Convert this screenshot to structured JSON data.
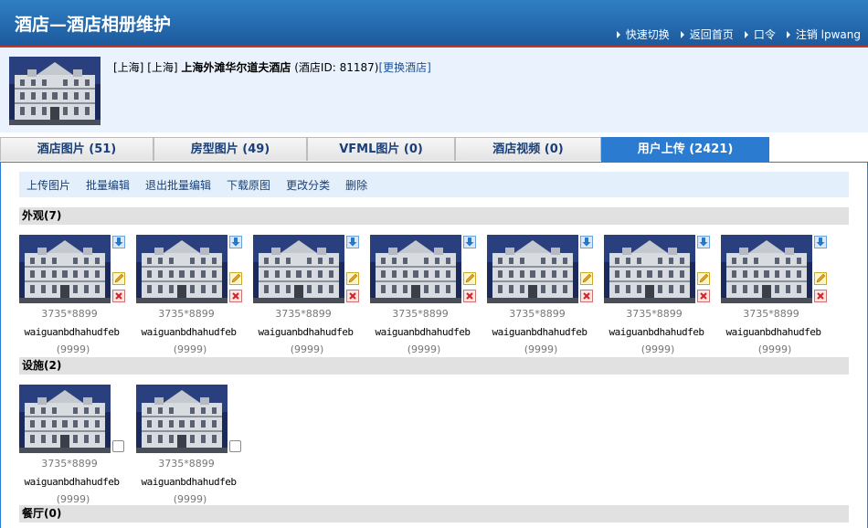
{
  "header": {
    "title": "酒店—酒店相册维护",
    "links": [
      "快速切换",
      "返回首页",
      "口令",
      "注销 lpwang"
    ]
  },
  "hotel": {
    "city1": "[上海]",
    "city2": "[上海]",
    "name": "上海外滩华尔道夫酒店",
    "id_text": "(酒店ID: 81187)",
    "change_link": "[更换酒店]"
  },
  "tabs": [
    {
      "label": "酒店图片 (51)",
      "active": false
    },
    {
      "label": "房型图片 (49)",
      "active": false
    },
    {
      "label": "VFML图片 (0)",
      "active": false
    },
    {
      "label": "酒店视频 (0)",
      "active": false
    },
    {
      "label": "用户上传 (2421)",
      "active": true
    }
  ],
  "actions": [
    "上传图片",
    "批量编辑",
    "退出批量编辑",
    "下载原图",
    "更改分类",
    "删除"
  ],
  "sections": [
    {
      "title": "外观(7)"
    },
    {
      "title": "设施(2)"
    },
    {
      "title": "餐厅(0)"
    }
  ],
  "photo": {
    "size": "3735*8899",
    "name": "waiguanbdhahudfeb",
    "count": "(9999)"
  },
  "colors": {
    "header": "#1c5a9c",
    "accent": "#2b7bd0",
    "info_bg": "#eaf3fd"
  }
}
